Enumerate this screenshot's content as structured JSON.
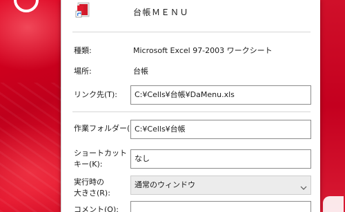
{
  "dialog": {
    "name": "台帳ＭＥＮＵ",
    "fields": {
      "type": {
        "label": "種類:",
        "value": "Microsoft Excel 97-2003 ワークシート"
      },
      "location": {
        "label": "場所:",
        "value": "台帳"
      },
      "target": {
        "label": "リンク先(T):",
        "value": "C:¥Cells¥台帳¥DaMenu.xls"
      },
      "start_in": {
        "label": "作業フォルダー(S):",
        "value": "C:¥Cells¥台帳"
      },
      "shortcut_key": {
        "label_line1": "ショートカット",
        "label_line2": "キー(K):",
        "value": "なし"
      },
      "run": {
        "label_line1": "実行時の",
        "label_line2": "大きさ(R):",
        "value": "通常のウィンドウ"
      },
      "comment": {
        "label": "コメント(O):",
        "value": ""
      }
    }
  },
  "icons": {
    "shortcut": "excel-shortcut-icon",
    "chevron": "chevron-down-icon"
  },
  "colors": {
    "wallpaper_red": "#c0001c",
    "dialog_bg": "#ffffff",
    "select_bg": "#ececec",
    "input_border": "#8a8a8a"
  }
}
